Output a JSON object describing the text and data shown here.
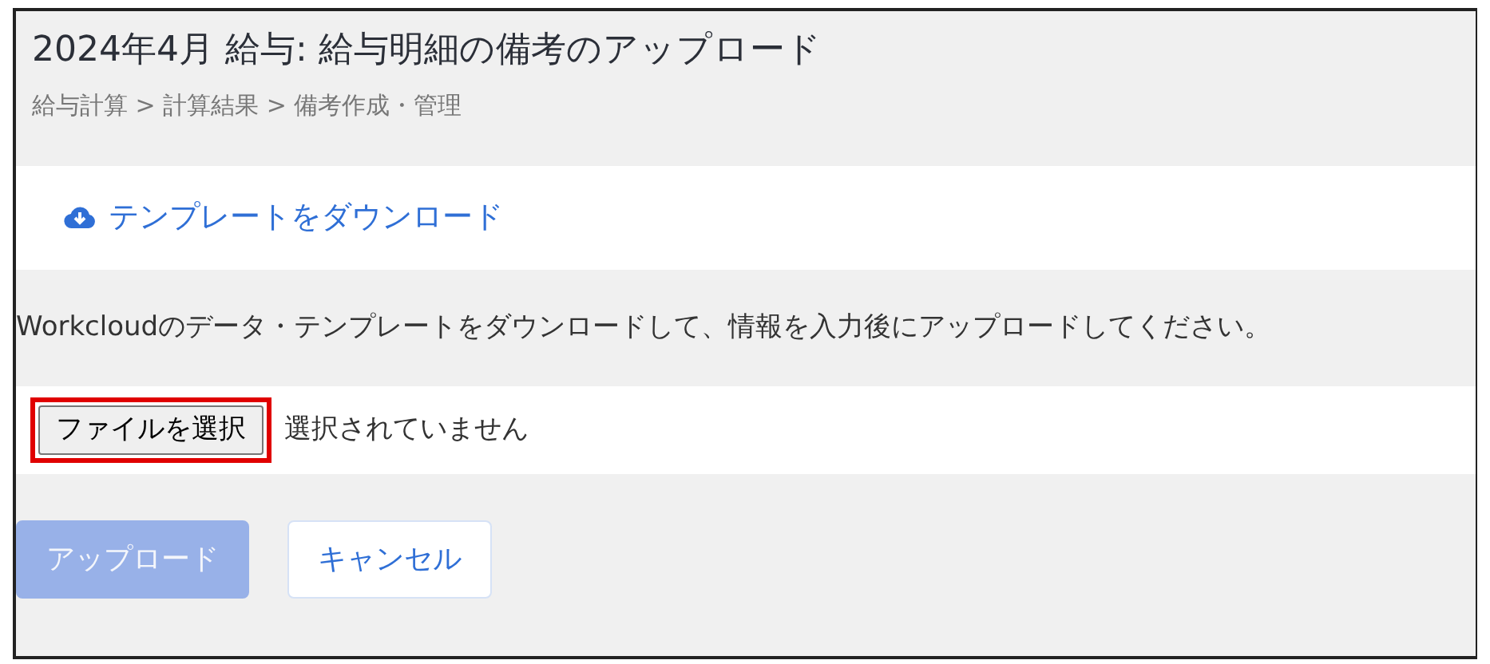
{
  "title": "2024年4月 給与: 給与明細の備考のアップロード",
  "breadcrumb": "給与計算 > 計算結果 > 備考作成・管理",
  "download_link": {
    "label": "テンプレートをダウンロード"
  },
  "instruction": "Workcloudのデータ・テンプレートをダウンロードして、情報を入力後にアップロードしてください。",
  "file_input": {
    "button": "ファイルを選択",
    "status": "選択されていません",
    "highlighted": true
  },
  "buttons": [
    {
      "kind": "primary",
      "label": "アップロード",
      "disabled": true
    },
    {
      "kind": "secondary",
      "label": "キャンセル",
      "disabled": false
    }
  ]
}
